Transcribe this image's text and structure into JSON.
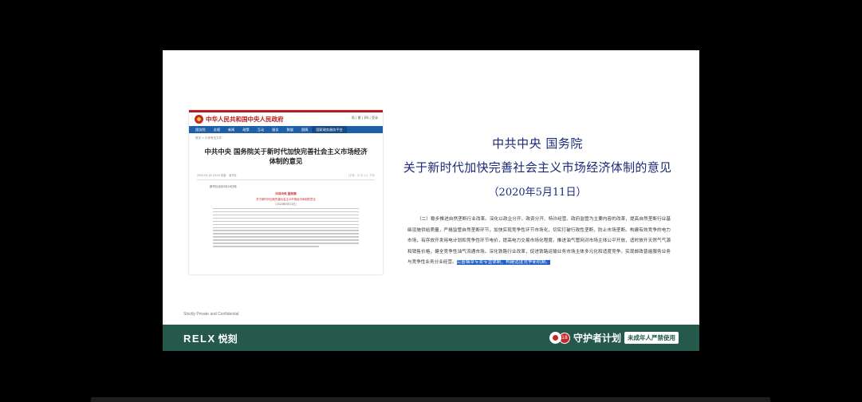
{
  "web_screenshot": {
    "site_title": "中华人民共和国中央人民政府",
    "header_links": "简 | 繁 | EN | 登录",
    "nav": [
      "国务院",
      "总理",
      "新闻",
      "政策",
      "互动",
      "服务",
      "数据",
      "国情",
      "国家政务服务平台"
    ],
    "breadcrumb": "首页 > 中央有关文件",
    "article_title": "中共中央 国务院关于新时代加快完善社会主义市场经济体制的意见",
    "meta_left": "2020-05-18 19:00    来源： 新华社",
    "meta_tools": "【字体：大 中 小】 打印",
    "note": "新华社北京5月18日电",
    "doc_head_1": "中共中央 国务院",
    "doc_head_2": "关于新时代加快完善社会主义市场经济体制的意见",
    "doc_head_3": "（2020年5月11日）"
  },
  "document": {
    "org": "中共中央  国务院",
    "title": "关于新时代加快完善社会主义市场经济体制的意见",
    "date": "（2020年5月11日）",
    "body": "（二）稳步推进自然垄断行业改革。深化以政企分开、政资分开、特许经营、政府监管为主要内容的改革，提高自然垄断行业基础设施供给质量，严格监管自然垄断环节，加快实现竞争性环节市场化，切实打破行政性垄断，防止市场垄断。构建有效竞争的电力市场，有序放开发用电计划和竞争性环节电价，提高电力交易市场化程度。推进油气管网对市场主体公平开放，适时放开天然气气源和销售价格，健全竞争性油气流通市场。深化铁路行业改革，促进铁路运输业务市场主体多元化和适度竞争。实现邮政普遍服务业务与竞争性业务分业经营。",
    "highlight": "完善烟草专卖专营体制，构建适度竞争新机制。"
  },
  "footer": {
    "note": "Strictly Private and Confidential",
    "logo_latin": "RELX",
    "logo_cn": "悦刻",
    "guardian_badge": "18",
    "guardian_text": "守护者计划",
    "guardian_sub": "未成年人严禁使用"
  },
  "colors": {
    "footer_bar": "#24594b",
    "doc_heading": "#1a2a78",
    "highlight": "#1d5ec9"
  }
}
